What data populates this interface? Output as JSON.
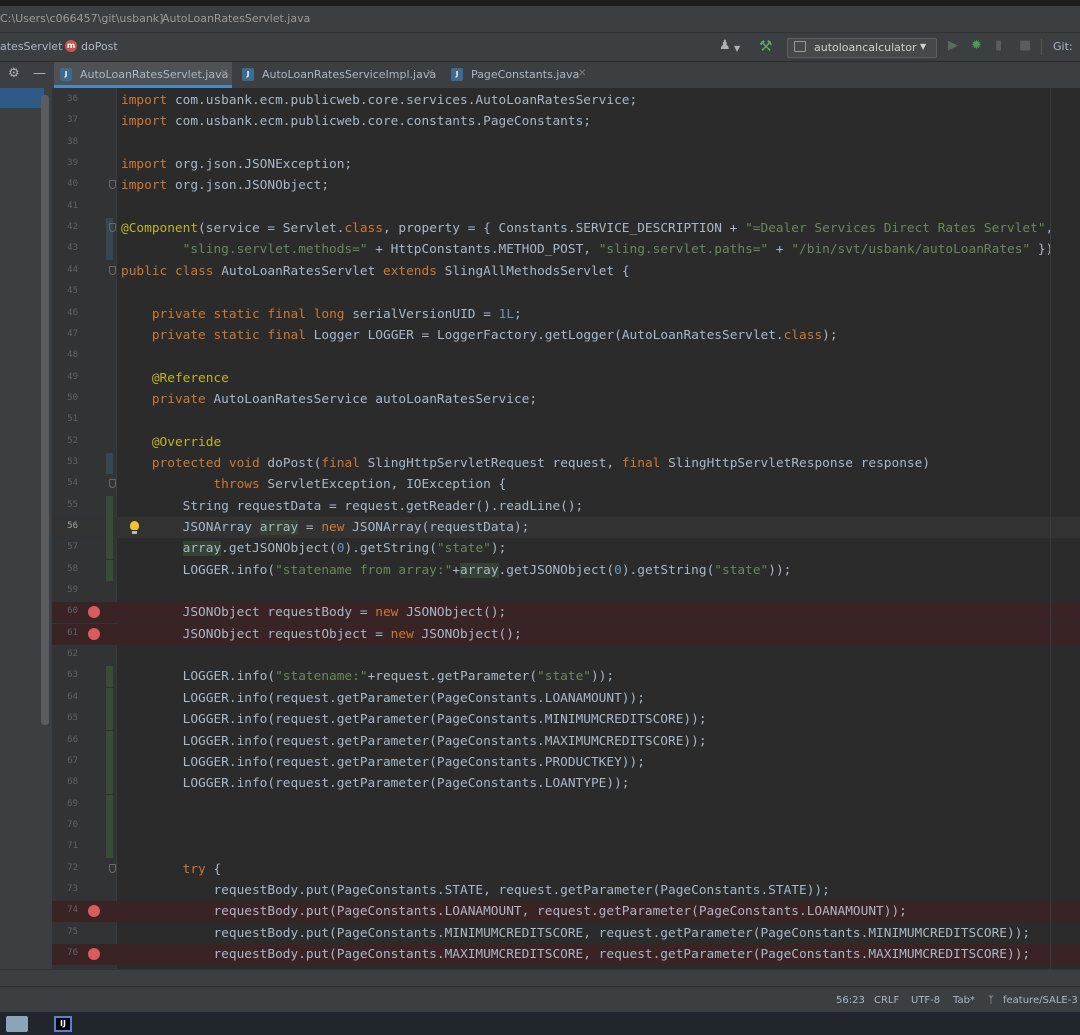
{
  "window": {
    "title_path": "C:\\Users\\c066457\\git\\usbank]",
    "title_file": "AutoLoanRatesServlet.java"
  },
  "navbar": {
    "class_crumb": "atesServlet",
    "method_crumb": "doPost",
    "method_badge": "m",
    "run_config": "autoloancalculator",
    "vcs_label": "Git:"
  },
  "tabs": [
    {
      "label": "AutoLoanRatesServlet.java",
      "active": true,
      "icon": "java-file-icon"
    },
    {
      "label": "AutoLoanRatesServiceImpl.java",
      "active": false,
      "icon": "java-file-icon"
    },
    {
      "label": "PageConstants.java",
      "active": false,
      "icon": "java-file-icon"
    }
  ],
  "editor": {
    "lines": [
      {
        "n": "36",
        "code": "import com.usbank.ecm.publicweb.core.services.AutoLoanRatesService;"
      },
      {
        "n": "37",
        "code": "import com.usbank.ecm.publicweb.core.constants.PageConstants;"
      },
      {
        "n": "38",
        "code": ""
      },
      {
        "n": "39",
        "code": "import org.json.JSONException;"
      },
      {
        "n": "40",
        "code": "import org.json.JSONObject;"
      },
      {
        "n": "41",
        "code": ""
      },
      {
        "n": "42",
        "code": "@Component(service = Servlet.class, property = { Constants.SERVICE_DESCRIPTION + \"=Dealer Services Direct Rates Servlet\","
      },
      {
        "n": "43",
        "code": "        \"sling.servlet.methods=\" + HttpConstants.METHOD_POST, \"sling.servlet.paths=\" + \"/bin/svt/usbank/autoLoanRates\" })"
      },
      {
        "n": "44",
        "code": "public class AutoLoanRatesServlet extends SlingAllMethodsServlet {"
      },
      {
        "n": "45",
        "code": ""
      },
      {
        "n": "46",
        "code": "    private static final long serialVersionUID = 1L;"
      },
      {
        "n": "47",
        "code": "    private static final Logger LOGGER = LoggerFactory.getLogger(AutoLoanRatesServlet.class);"
      },
      {
        "n": "48",
        "code": ""
      },
      {
        "n": "49",
        "code": "    @Reference"
      },
      {
        "n": "50",
        "code": "    private AutoLoanRatesService autoLoanRatesService;"
      },
      {
        "n": "51",
        "code": ""
      },
      {
        "n": "52",
        "code": "    @Override"
      },
      {
        "n": "53",
        "code": "    protected void doPost(final SlingHttpServletRequest request, final SlingHttpServletResponse response)"
      },
      {
        "n": "54",
        "code": "            throws ServletException, IOException {"
      },
      {
        "n": "55",
        "code": "        String requestData = request.getReader().readLine();"
      },
      {
        "n": "56",
        "code": "        JSONArray array = new JSONArray(requestData);"
      },
      {
        "n": "57",
        "code": "        array.getJSONObject(0).getString(\"state\");"
      },
      {
        "n": "58",
        "code": "        LOGGER.info(\"statename from array:\"+array.getJSONObject(0).getString(\"state\"));"
      },
      {
        "n": "59",
        "code": ""
      },
      {
        "n": "60",
        "code": "        JSONObject requestBody = new JSONObject();"
      },
      {
        "n": "61",
        "code": "        JSONObject requestObject = new JSONObject();"
      },
      {
        "n": "62",
        "code": ""
      },
      {
        "n": "63",
        "code": "        LOGGER.info(\"statename:\"+request.getParameter(\"state\"));"
      },
      {
        "n": "64",
        "code": "        LOGGER.info(request.getParameter(PageConstants.LOANAMOUNT));"
      },
      {
        "n": "65",
        "code": "        LOGGER.info(request.getParameter(PageConstants.MINIMUMCREDITSCORE));"
      },
      {
        "n": "66",
        "code": "        LOGGER.info(request.getParameter(PageConstants.MAXIMUMCREDITSCORE));"
      },
      {
        "n": "67",
        "code": "        LOGGER.info(request.getParameter(PageConstants.PRODUCTKEY));"
      },
      {
        "n": "68",
        "code": "        LOGGER.info(request.getParameter(PageConstants.LOANTYPE));"
      },
      {
        "n": "69",
        "code": ""
      },
      {
        "n": "70",
        "code": ""
      },
      {
        "n": "71",
        "code": ""
      },
      {
        "n": "72",
        "code": "        try {"
      },
      {
        "n": "73",
        "code": "            requestBody.put(PageConstants.STATE, request.getParameter(PageConstants.STATE));"
      },
      {
        "n": "74",
        "code": "            requestBody.put(PageConstants.LOANAMOUNT, request.getParameter(PageConstants.LOANAMOUNT));"
      },
      {
        "n": "75",
        "code": "            requestBody.put(PageConstants.MINIMUMCREDITSCORE, request.getParameter(PageConstants.MINIMUMCREDITSCORE));"
      },
      {
        "n": "76",
        "code": "            requestBody.put(PageConstants.MAXIMUMCREDITSCORE, request.getParameter(PageConstants.MAXIMUMCREDITSCORE));"
      }
    ],
    "current_line": "56",
    "breakpoint_lines": [
      "60",
      "61",
      "74",
      "76"
    ],
    "bulb_line": "56"
  },
  "status": {
    "position": "56:23",
    "line_separator": "CRLF",
    "encoding": "UTF-8",
    "indent": "Tab*",
    "branch": "feature/SALE-3"
  },
  "colors": {
    "background": "#2b2b2b",
    "keyword": "#cc7832",
    "string": "#6a8759",
    "annotation": "#bbb529",
    "number": "#6897bb",
    "breakpoint": "#db5c5c"
  }
}
